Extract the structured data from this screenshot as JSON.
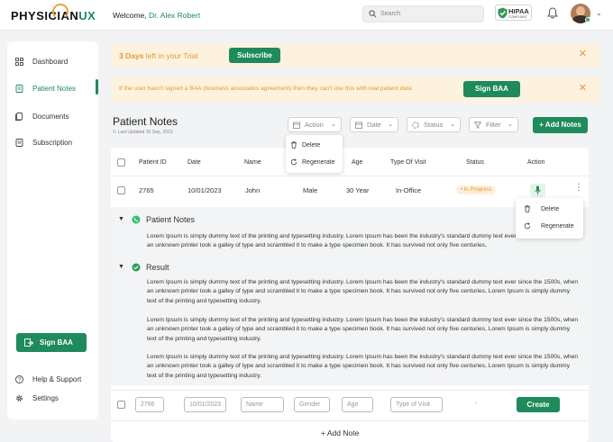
{
  "header": {
    "logo_main": "PHYSICIAN",
    "logo_accent": "UX",
    "welcome_prefix": "Welcome,",
    "welcome_name": "Dr. Alex Robert",
    "search_placeholder": "Search",
    "hipaa_title": "HIPAA",
    "hipaa_sub": "COMPLIANT"
  },
  "sidebar": {
    "items": [
      {
        "label": "Dashboard",
        "icon": "grid-icon"
      },
      {
        "label": "Patient Notes",
        "icon": "notes-icon"
      },
      {
        "label": "Documents",
        "icon": "documents-icon"
      },
      {
        "label": "Subscription",
        "icon": "subscription-icon"
      }
    ],
    "sign_baa": "Sign BAA",
    "bottom": [
      {
        "label": "Help & Support",
        "icon": "help-icon"
      },
      {
        "label": "Settings",
        "icon": "gear-icon"
      }
    ]
  },
  "banners": {
    "trial_bold": "3 Days",
    "trial_rest": " left in your Trial",
    "subscribe": "Subscribe",
    "baa_text": "If the user hasn't signed a BAA (business associates agreement) then they can't use this with real patient data",
    "sign_baa": "Sign BAA"
  },
  "notes": {
    "title": "Patient Notes",
    "last_updated": "Last Updated 30 Sep, 2023",
    "filters": {
      "action": "Action",
      "date": "Date",
      "status": "Status",
      "filter": "Filter"
    },
    "add_notes": "+ Add Notes"
  },
  "action_menu": {
    "delete": "Delete",
    "regenerate": "Regenerate"
  },
  "row_menu": {
    "delete": "Delete",
    "regenerate": "Regenerate"
  },
  "table": {
    "headers": [
      "Patient ID",
      "Date",
      "Name",
      "",
      "Age",
      "Type Of Visit",
      "Status",
      "Action"
    ],
    "row": {
      "id": "2765",
      "date": "10/01/2023",
      "name": "John",
      "gender": "Male",
      "age": "30 Year",
      "visit": "In-Office",
      "status": "• In Progress"
    }
  },
  "expand": {
    "notes_title": "Patient Notes",
    "notes_text": "Lorem Ipsum is simply dummy text of the printing and typesetting industry. Lorem Ipsum has been the industry's standard dummy text ever since the 1500s, when an unknown printer took a galley of type and scrambled it to make a type specimen book. It has survived not only five centuries,",
    "result_title": "Result",
    "result_paras": [
      "Lorem Ipsum is simply dummy text of the printing and typesetting industry. Lorem Ipsum has been the industry's standard dummy text ever since the 1500s, when an unknown printer took a galley of type and scrambled it to make a type specimen book. It has survived not only five centuries, Lorem Ipsum is simply dummy text of the printing and typesetting industry.",
      "Lorem Ipsum is simply dummy text of the printing and typesetting industry. Lorem Ipsum has been the industry's standard dummy text ever since the 1500s, when an unknown printer took a galley of type and scrambled it to make a type specimen book. It has survived not only five centuries, Lorem Ipsum is simply dummy text of the printing and typesetting industry.",
      "Lorem Ipsum is simply dummy text of the printing and typesetting industry. Lorem Ipsum has been the industry's standard dummy text ever since the 1500s, when an unknown printer took a galley of type and scrambled it to make a type specimen book. It has survived not only five centuries, Lorem Ipsum is simply dummy text of the printing and typesetting industry."
    ]
  },
  "new_row": {
    "id": "2766",
    "date": "10/01/2023",
    "name_ph": "Name",
    "gender_ph": "Gender",
    "age_ph": "Age",
    "visit_ph": "Type of Visit",
    "status": "-",
    "create": "Create"
  },
  "add_note": "+ Add Note",
  "colors": {
    "accent": "#1f8a5b",
    "warning": "#e39834",
    "banner_bg": "#fdf2de"
  }
}
